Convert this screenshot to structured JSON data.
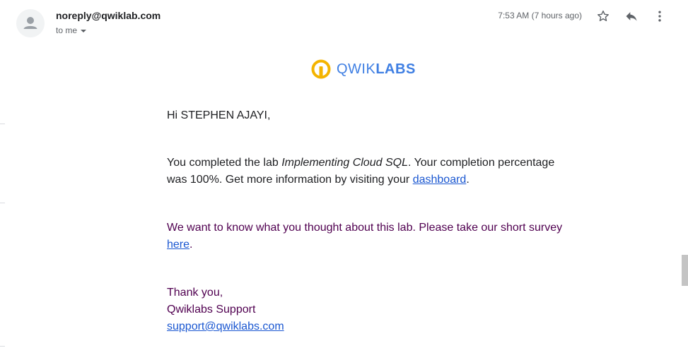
{
  "header": {
    "sender": "noreply@qwiklab.com",
    "recipient": "to me",
    "timestamp": "7:53 AM (7 hours ago)"
  },
  "icons": {
    "avatar": "person-avatar-icon",
    "star": "star-outline-icon",
    "reply": "reply-arrow-icon",
    "more": "vertical-dots-icon",
    "logo": "qwiklabs-logo-icon"
  },
  "logo": {
    "part1": "QWIK",
    "part2": "LABS",
    "colors": {
      "ring": "#f4b400",
      "text": "#3f7fe3"
    }
  },
  "message": {
    "greeting": "Hi STEPHEN AJAYI,",
    "para1_pre": "You completed the lab ",
    "lab_name": "Implementing Cloud SQL",
    "para1_mid": ". Your completion percentage was 100%. Get more information by visiting your ",
    "dashboard_link": "dashboard",
    "para1_end": ".",
    "para2_pre": "We want to know what you thought about this lab. Please take our short survey ",
    "survey_link": "here",
    "para2_end": ".",
    "thanks": "Thank you,",
    "team": "Qwiklabs Support",
    "support_email": "support@qwiklabs.com"
  }
}
